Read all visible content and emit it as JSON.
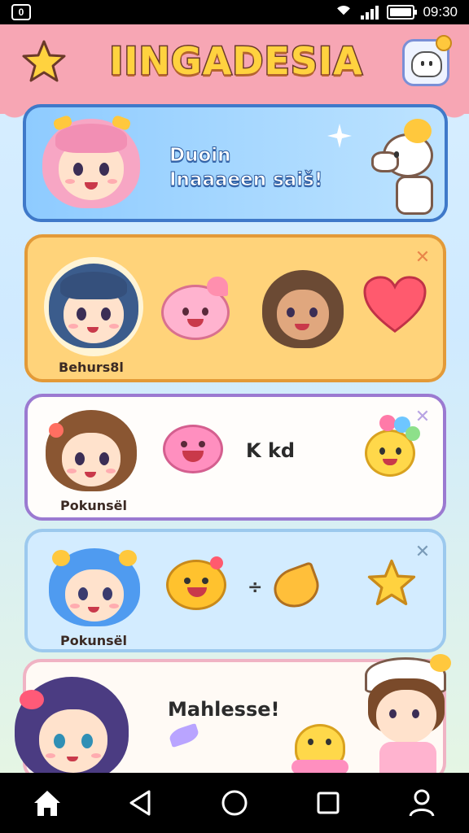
{
  "status_bar": {
    "notification": "0",
    "time": "09:30"
  },
  "header": {
    "title": "IINGADESIA"
  },
  "hero": {
    "text_line1": "Duoin",
    "text_line2": "Inaaaeen saiš!"
  },
  "rows": [
    {
      "label": "Behurs8l"
    },
    {
      "label": "Pokunsël",
      "text": "K kd"
    },
    {
      "label": "Pokunsël"
    },
    {
      "text": "Mahlesse!"
    }
  ],
  "icons": {
    "star": "star-icon",
    "profile": "profile-icon",
    "close": "close-icon",
    "home": "home-icon",
    "back": "back-icon",
    "circle": "home-circle-icon",
    "recent": "recent-apps-icon",
    "account": "account-icon"
  },
  "colors": {
    "header": "#f7a6b4",
    "title_fill": "#ffd23f",
    "hero_border": "#3f79c9",
    "row1_bg": "#ffd37a",
    "row2_border": "#9b7ad1",
    "row3_bg": "#d3ecff"
  }
}
